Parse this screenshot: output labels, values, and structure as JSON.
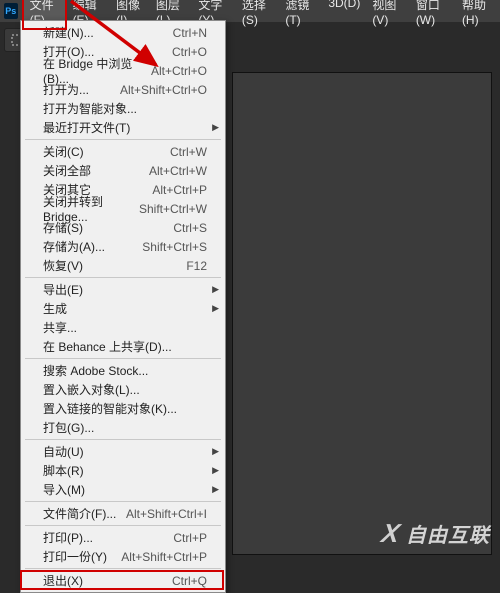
{
  "app": {
    "icon_text": "Ps"
  },
  "menubar": [
    "文件(F)",
    "编辑(E)",
    "图像(I)",
    "图层(L)",
    "文字(Y)",
    "选择(S)",
    "滤镜(T)",
    "3D(D)",
    "视图(V)",
    "窗口(W)",
    "帮助(H)"
  ],
  "menu_open_index": 0,
  "file_menu": {
    "groups": [
      [
        {
          "label": "新建(N)...",
          "shortcut": "Ctrl+N"
        },
        {
          "label": "打开(O)...",
          "shortcut": "Ctrl+O"
        },
        {
          "label": "在 Bridge 中浏览(B)...",
          "shortcut": "Alt+Ctrl+O"
        },
        {
          "label": "打开为...",
          "shortcut": "Alt+Shift+Ctrl+O"
        },
        {
          "label": "打开为智能对象...",
          "shortcut": ""
        },
        {
          "label": "最近打开文件(T)",
          "shortcut": "",
          "submenu": true
        }
      ],
      [
        {
          "label": "关闭(C)",
          "shortcut": "Ctrl+W"
        },
        {
          "label": "关闭全部",
          "shortcut": "Alt+Ctrl+W"
        },
        {
          "label": "关闭其它",
          "shortcut": "Alt+Ctrl+P"
        },
        {
          "label": "关闭并转到 Bridge...",
          "shortcut": "Shift+Ctrl+W"
        },
        {
          "label": "存储(S)",
          "shortcut": "Ctrl+S"
        },
        {
          "label": "存储为(A)...",
          "shortcut": "Shift+Ctrl+S"
        },
        {
          "label": "恢复(V)",
          "shortcut": "F12"
        }
      ],
      [
        {
          "label": "导出(E)",
          "shortcut": "",
          "submenu": true
        },
        {
          "label": "生成",
          "shortcut": "",
          "submenu": true
        },
        {
          "label": "共享...",
          "shortcut": ""
        },
        {
          "label": "在 Behance 上共享(D)...",
          "shortcut": ""
        }
      ],
      [
        {
          "label": "搜索 Adobe Stock...",
          "shortcut": ""
        },
        {
          "label": "置入嵌入对象(L)...",
          "shortcut": ""
        },
        {
          "label": "置入链接的智能对象(K)...",
          "shortcut": ""
        },
        {
          "label": "打包(G)...",
          "shortcut": ""
        }
      ],
      [
        {
          "label": "自动(U)",
          "shortcut": "",
          "submenu": true
        },
        {
          "label": "脚本(R)",
          "shortcut": "",
          "submenu": true
        },
        {
          "label": "导入(M)",
          "shortcut": "",
          "submenu": true
        }
      ],
      [
        {
          "label": "文件简介(F)...",
          "shortcut": "Alt+Shift+Ctrl+I"
        }
      ],
      [
        {
          "label": "打印(P)...",
          "shortcut": "Ctrl+P"
        },
        {
          "label": "打印一份(Y)",
          "shortcut": "Alt+Shift+Ctrl+P"
        }
      ],
      [
        {
          "label": "退出(X)",
          "shortcut": "Ctrl+Q"
        }
      ]
    ]
  },
  "watermark": {
    "text": "自由互联",
    "x": "X"
  }
}
